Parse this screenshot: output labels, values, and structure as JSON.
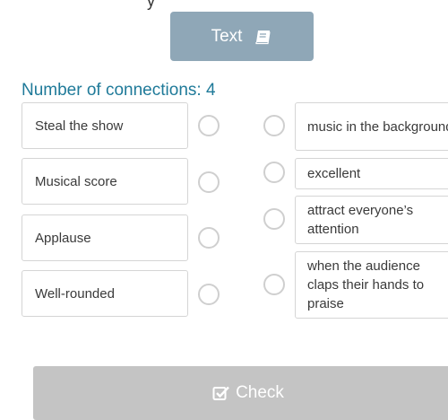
{
  "header": {
    "cut_text": "y"
  },
  "text_button": {
    "label": "Text",
    "icon": "book-icon"
  },
  "connections": {
    "label": "Number of connections: 4"
  },
  "left_items": [
    {
      "label": "Steal the show"
    },
    {
      "label": "Musical score"
    },
    {
      "label": "Applause"
    },
    {
      "label": "Well-rounded"
    }
  ],
  "right_items": [
    {
      "label": "music in the background"
    },
    {
      "label": "excellent"
    },
    {
      "label": "attract everyone’s attention"
    },
    {
      "label": "when the audience claps their hands to praise"
    }
  ],
  "check_button": {
    "label": "Check",
    "icon": "check-square-icon"
  },
  "colors": {
    "text_button_bg": "#8fa7b7",
    "label_color": "#1f7a99",
    "check_button_bg": "#c4c4c4"
  }
}
